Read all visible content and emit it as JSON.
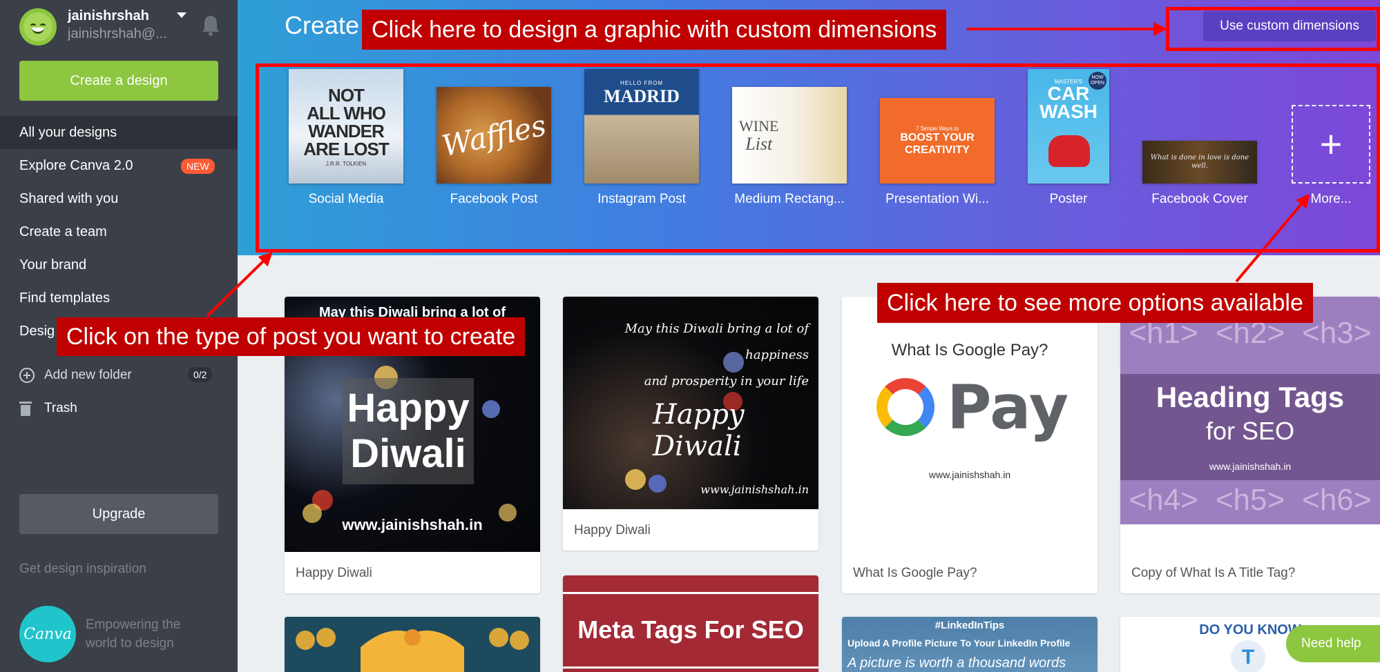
{
  "user": {
    "name": "jainishrshah",
    "email": "jainishrshah@..."
  },
  "sidebar": {
    "create_button": "Create a design",
    "items": [
      {
        "label": "All your designs"
      },
      {
        "label": "Explore Canva 2.0",
        "badge": "NEW"
      },
      {
        "label": "Shared with you"
      },
      {
        "label": "Create a team"
      },
      {
        "label": "Your brand"
      },
      {
        "label": "Find templates"
      },
      {
        "label": "Desig"
      }
    ],
    "add_folder": "Add new folder",
    "folder_count": "0/2",
    "trash": "Trash",
    "upgrade_button": "Upgrade",
    "inspiration": "Get design inspiration",
    "logo_text": "Canva",
    "tagline": "Empowering the world to design"
  },
  "header": {
    "title": "Create",
    "custom_dimensions_button": "Use custom dimensions"
  },
  "design_types": [
    {
      "label": "Social Media",
      "thumb_lines": [
        "NOT",
        "ALL WHO",
        "WANDER",
        "ARE LOST"
      ],
      "thumb_small": "J.R.R. TOLKIEN"
    },
    {
      "label": "Facebook Post",
      "thumb_text": "Waffles"
    },
    {
      "label": "Instagram Post",
      "thumb_small": "HELLO FROM",
      "thumb_text": "MADRID"
    },
    {
      "label": "Medium Rectang...",
      "thumb_text": "WINE",
      "thumb_text2": "List"
    },
    {
      "label": "Presentation Wi...",
      "thumb_small": "7 Simple Ways to",
      "thumb_text": "BOOST YOUR CREATIVITY"
    },
    {
      "label": "Poster",
      "thumb_small": "MASTER'S",
      "thumb_text": "CAR WASH",
      "thumb_badge": "NOW OPEN"
    },
    {
      "label": "Facebook Cover",
      "thumb_text": "What is done in love is done well."
    },
    {
      "label": "More...",
      "icon": "plus-icon"
    }
  ],
  "annotations": {
    "custom": "Click here to design a graphic with custom dimensions",
    "type": "Click on the type of post you want to create",
    "more": "Click here to see more options available"
  },
  "designs": [
    {
      "title": "Happy Diwali",
      "top_text": "May this Diwali bring a lot of",
      "text": "Happy Diwali",
      "url": "www.jainishshah.in"
    },
    {
      "title": "Happy Diwali",
      "lines": [
        "May this Diwali bring a lot of happiness",
        "and prosperity in your life"
      ],
      "text": "Happy Diwali",
      "url": "www.jainishshah.in"
    },
    {
      "title": "What Is Google Pay?",
      "question": "What Is Google Pay?",
      "logo_text": "Pay",
      "url": "www.jainishshah.in"
    },
    {
      "title": "Copy of What Is A Title Tag?",
      "heading": "Heading Tags",
      "sub": "for SEO",
      "url": "www.jainishshah.in",
      "tags_top": [
        "<h1>",
        "<h2>",
        "<h3>"
      ],
      "tags_bottom": [
        "<h4>",
        "<h5>",
        "<h6>"
      ]
    },
    {
      "title": "Meta Tags For SEO",
      "text": "Meta Tags For SEO"
    },
    {
      "hashtag": "#LinkedInTips",
      "line1": "Upload A Profile Picture To Your LinkedIn Profile",
      "line2": "A picture is worth a thousand words"
    },
    {
      "text": "DO YOU KNOW",
      "logo": "T"
    }
  ],
  "need_help": "Need help",
  "colors": {
    "sidebar": "#3b3f48",
    "accent_green": "#8dc63f",
    "annotation_red": "#c00000",
    "new_badge": "#ff5a36"
  }
}
